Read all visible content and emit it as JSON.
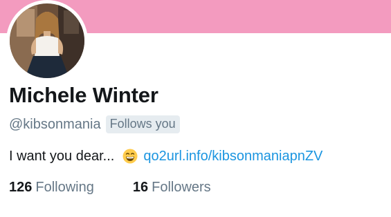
{
  "colors": {
    "banner": "#f39bbf",
    "text_primary": "#14171a",
    "text_secondary": "#657786",
    "link": "#1b95e0",
    "badge_bg": "#e6ecf0"
  },
  "profile": {
    "display_name": "Michele Winter",
    "handle": "@kibsonmania",
    "follows_you_badge": "Follows you",
    "avatar_icon": "profile-photo",
    "bio": {
      "text": "I want you dear...",
      "emoji_icon": "grinning-face-emoji",
      "link": "qo2url.info/kibsonmaniapnZV"
    },
    "stats": [
      {
        "count": "126",
        "label": "Following"
      },
      {
        "count": "16",
        "label": "Followers"
      }
    ]
  }
}
